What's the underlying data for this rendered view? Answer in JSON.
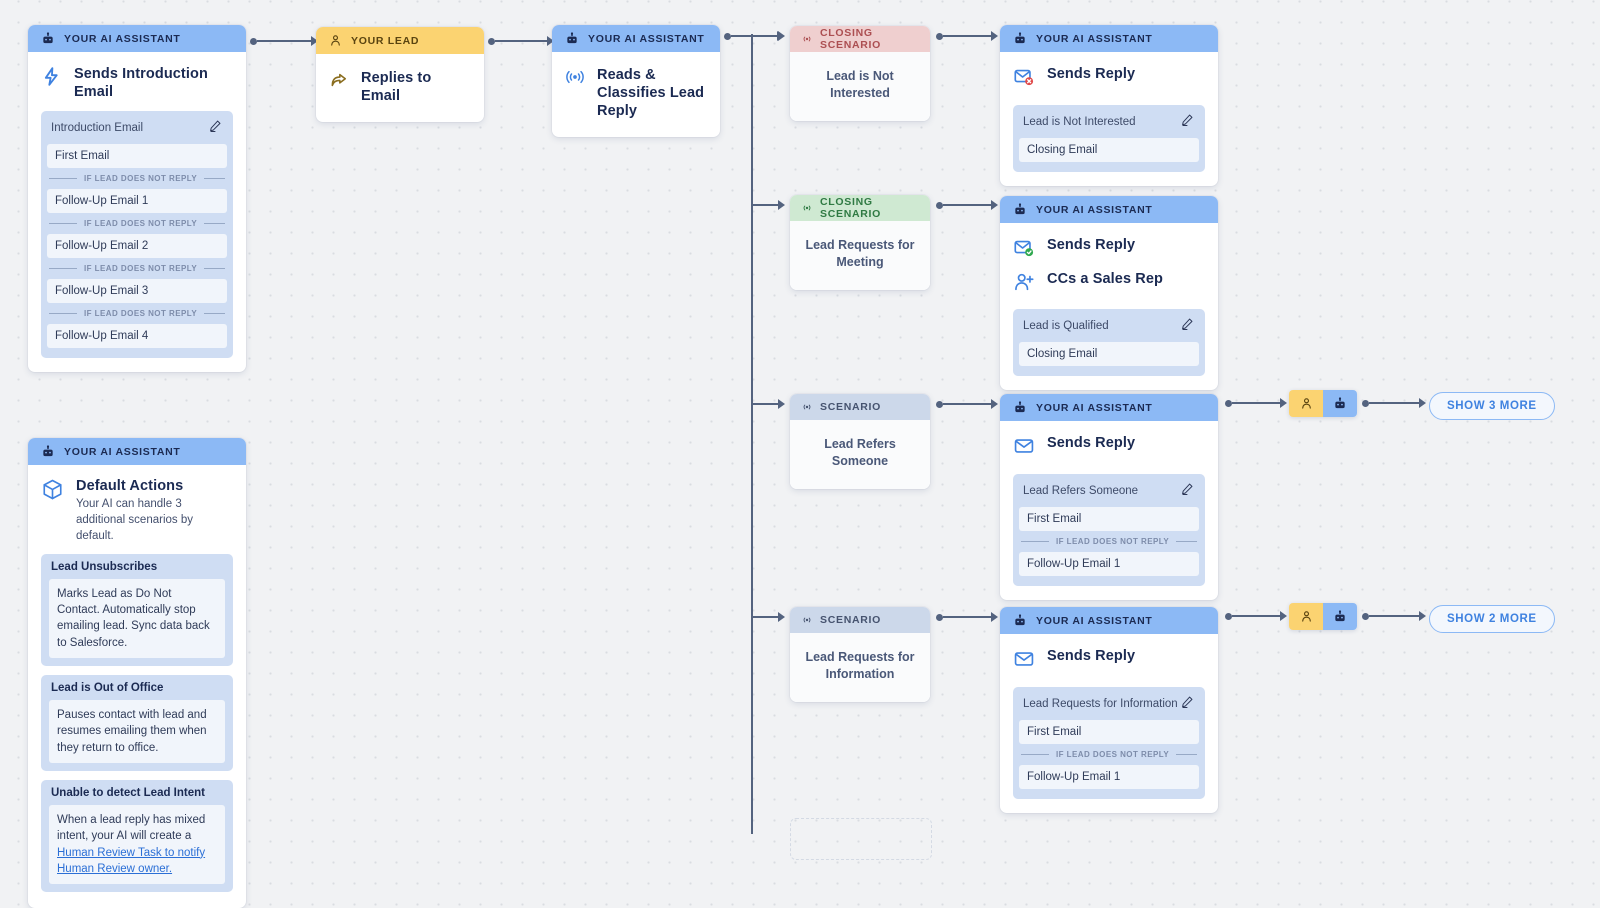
{
  "labels": {
    "ai_assistant": "YOUR AI ASSISTANT",
    "your_lead": "YOUR LEAD",
    "closing_scenario": "CLOSING SCENARIO",
    "scenario": "SCENARIO",
    "if_no_reply": "IF LEAD DOES NOT REPLY"
  },
  "intro_node": {
    "header": "YOUR AI ASSISTANT",
    "action": "Sends Introduction Email",
    "sequence_title": "Introduction Email",
    "steps": [
      "First Email",
      "Follow-Up Email 1",
      "Follow-Up Email 2",
      "Follow-Up Email 3",
      "Follow-Up Email 4"
    ]
  },
  "lead_node": {
    "header": "YOUR LEAD",
    "action": "Replies to Email"
  },
  "classify_node": {
    "header": "YOUR AI ASSISTANT",
    "action": "Reads & Classifies Lead Reply"
  },
  "branches": [
    {
      "scenario_header": "CLOSING SCENARIO",
      "scenario_kind": "closing-red",
      "scenario_title": "Lead is Not Interested",
      "card_header": "YOUR AI ASSISTANT",
      "actions": [
        {
          "icon": "mail-declined-icon",
          "label": "Sends Reply"
        }
      ],
      "sequence_title": "Lead is Not Interested",
      "steps": [
        "Closing Email"
      ]
    },
    {
      "scenario_header": "CLOSING SCENARIO",
      "scenario_kind": "closing-green",
      "scenario_title": "Lead Requests for Meeting",
      "card_header": "YOUR AI ASSISTANT",
      "actions": [
        {
          "icon": "mail-approved-icon",
          "label": "Sends Reply"
        },
        {
          "icon": "user-add-icon",
          "label": "CCs a Sales Rep"
        }
      ],
      "sequence_title": "Lead is Qualified",
      "steps": [
        "Closing Email"
      ]
    },
    {
      "scenario_header": "SCENARIO",
      "scenario_kind": "scenario",
      "scenario_title": "Lead Refers Someone",
      "card_header": "YOUR AI ASSISTANT",
      "actions": [
        {
          "icon": "mail-icon",
          "label": "Sends Reply"
        }
      ],
      "sequence_title": "Lead Refers Someone",
      "steps": [
        "First Email",
        "Follow-Up Email 1"
      ],
      "tail": {
        "show_more": "SHOW 3 MORE"
      }
    },
    {
      "scenario_header": "SCENARIO",
      "scenario_kind": "scenario",
      "scenario_title": "Lead Requests for Information",
      "card_header": "YOUR AI ASSISTANT",
      "actions": [
        {
          "icon": "mail-icon",
          "label": "Sends Reply"
        }
      ],
      "sequence_title": "Lead Requests for Information",
      "steps": [
        "First Email",
        "Follow-Up Email 1"
      ],
      "tail": {
        "show_more": "SHOW 2 MORE"
      }
    }
  ],
  "default_actions": {
    "header": "YOUR AI ASSISTANT",
    "title": "Default Actions",
    "subtitle": "Your AI can handle 3 additional scenarios by default.",
    "blocks": [
      {
        "title": "Lead Unsubscribes",
        "text": "Marks Lead as Do Not Contact. Automatically stop emailing lead. Sync data back to Salesforce."
      },
      {
        "title": "Lead is Out of Office",
        "text": "Pauses contact with lead and resumes emailing them when they return to office."
      },
      {
        "title": "Unable to detect Lead Intent",
        "text_before": "When a lead reply has mixed intent, your AI will create a ",
        "link": "Human Review Task to notify Human Review owner."
      }
    ]
  },
  "colors": {
    "ai_header": "#8cb9f5",
    "lead_header": "#fbd371",
    "closing_red": "#efcfcf",
    "closing_green": "#cfe9d2",
    "scenario_header": "#ccd8ea",
    "accent_blue": "#3f82e0",
    "canvas": "#f1f2f4"
  }
}
